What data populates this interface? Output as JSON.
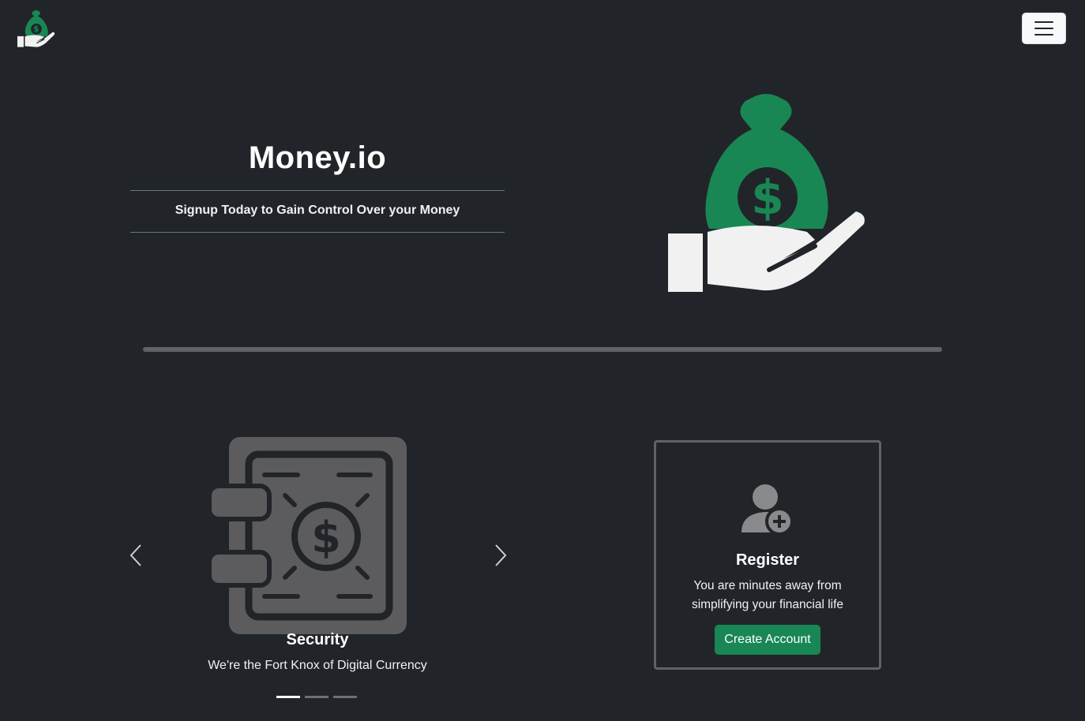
{
  "navbar": {
    "brand_icon": "money-bag-hand-icon",
    "toggle_icon": "hamburger-menu-icon"
  },
  "hero": {
    "title": "Money.io",
    "subtitle": "Signup Today to Gain Control Over your Money",
    "image_icon": "money-bag-hand-icon"
  },
  "carousel": {
    "slides": [
      {
        "title": "Security",
        "caption": "We're the Fort Knox of Digital Currency",
        "icon": "vault-safe-icon"
      }
    ],
    "active_index": 0,
    "indicator_count": 3,
    "prev_icon": "chevron-left-icon",
    "next_icon": "chevron-right-icon"
  },
  "register_card": {
    "icon": "user-add-icon",
    "title": "Register",
    "text": "You are minutes away from simplifying your financial life",
    "button_label": "Create Account"
  },
  "colors": {
    "background": "#212529",
    "accent_green": "#198754",
    "icon_gray": "#5c5c5e",
    "hand_white": "#f1f1f1"
  }
}
